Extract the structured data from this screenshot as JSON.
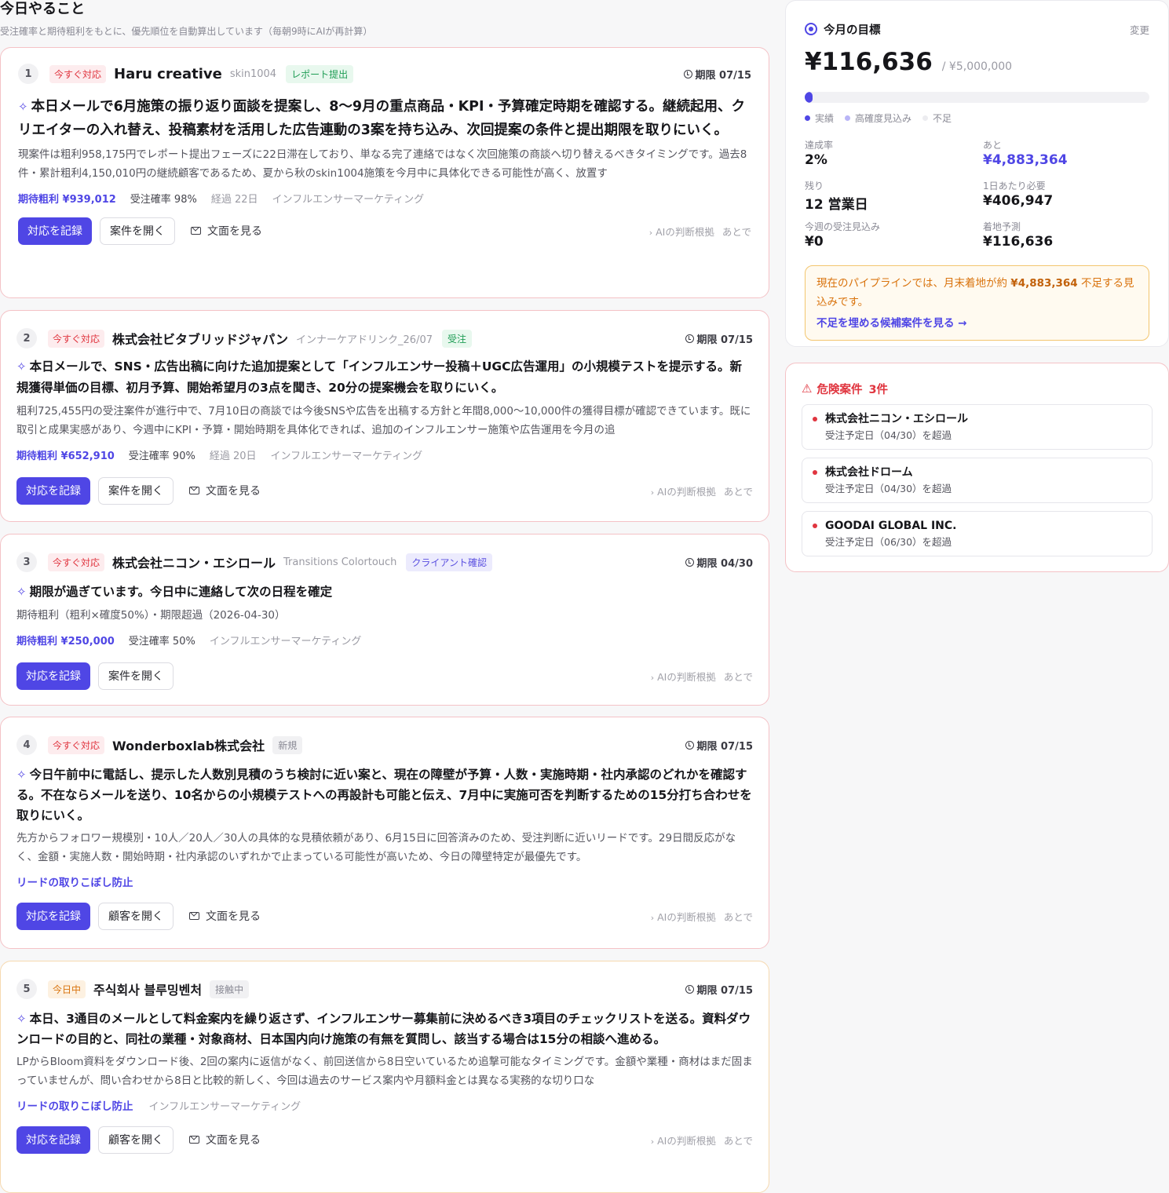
{
  "header": {
    "title": "今日やること",
    "subtitle": "受注確率と期待粗利をもとに、優先順位を自動算出しています（毎朝9時にAIが再計算）"
  },
  "common": {
    "record_label": "対応を記録",
    "view_text_label": "文面を見る",
    "ai_reason_label": "AIの判断根拠",
    "later_label": "あとで"
  },
  "tasks": [
    {
      "number": "1",
      "priority": "今すぐ対応",
      "company": "Haru creative",
      "project": "skin1004",
      "stage": "レポート提出",
      "deadline": "期限 07/15",
      "action": "本日メールで6月施策の振り返り面談を提案し、8〜9月の重点商品・KPI・予算確定時期を確認する。継続起用、クリエイターの入れ替え、投稿素材を活用した広告連動の3案を持ち込み、次回提案の条件と提出期限を取りにいく。",
      "reason": "現案件は粗利958,175円でレポート提出フェーズに22日滞在しており、単なる完了連絡ではなく次回施策の商談へ切り替えるべきタイミングです。過去8件・累計粗利4,150,010円の継続顧客であるため、夏から秋のskin1004施策を今月中に具体化できる可能性が高く、放置す",
      "expected": "期待粗利 ¥939,012",
      "probability": "受注確率 98%",
      "elapsed": "経過 22日",
      "category": "インフルエンサーマーケティング",
      "open_label": "案件を開く"
    },
    {
      "number": "2",
      "priority": "今すぐ対応",
      "company": "株式会社ビタブリッドジャパン",
      "project": "インナーケアドリンク_26/07",
      "stage": "受注",
      "deadline": "期限 07/15",
      "action": "本日メールで、SNS・広告出稿に向けた追加提案として「インフルエンサー投稿＋UGC広告運用」の小規模テストを提示する。新規獲得単価の目標、初月予算、開始希望月の3点を聞き、20分の提案機会を取りにいく。",
      "reason": "粗利725,455円の受注案件が進行中で、7月10日の商談では今後SNSや広告を出稿する方針と年間8,000〜10,000件の獲得目標が確認できています。既に取引と成果実感があり、今週中にKPI・予算・開始時期を具体化できれば、追加のインフルエンサー施策や広告運用を今月の追",
      "expected": "期待粗利 ¥652,910",
      "probability": "受注確率 90%",
      "elapsed": "経過 20日",
      "category": "インフルエンサーマーケティング",
      "open_label": "案件を開く"
    },
    {
      "number": "3",
      "priority": "今すぐ対応",
      "company": "株式会社ニコン・エシロール",
      "project": "Transitions Colortouch",
      "stage": "クライアント確認",
      "deadline": "期限 04/30",
      "action": "期限が過ぎています。今日中に連絡して次の日程を確定",
      "reason": "期待粗利（粗利×確度50%）・期限超過（2026-04-30）",
      "expected": "期待粗利 ¥250,000",
      "probability": "受注確率 50%",
      "category": "インフルエンサーマーケティング",
      "open_label": "案件を開く"
    },
    {
      "number": "4",
      "priority": "今すぐ対応",
      "company": "Wonderboxlab株式会社",
      "stage": "新規",
      "deadline": "期限 07/15",
      "action": "今日午前中に電話し、提示した人数別見積のうち検討に近い案と、現在の障壁が予算・人数・実施時期・社内承認のどれかを確認する。不在ならメールを送り、10名からの小規模テストへの再設計も可能と伝え、7月中に実施可否を判断するための15分打ち合わせを取りにいく。",
      "reason": "先方からフォロワー規模別・10人／20人／30人の具体的な見積依頼があり、6月15日に回答済みのため、受注判断に近いリードです。29日間反応がなく、金額・実施人数・開始時期・社内承認のいずれかで止まっている可能性が高いため、今日の障壁特定が最優先です。",
      "lead_tag": "リードの取りこぼし防止",
      "open_label": "顧客を開く"
    },
    {
      "number": "5",
      "priority": "今日中",
      "company": "주식회사 블루밍벤처",
      "stage": "接触中",
      "deadline": "期限 07/15",
      "action": "本日、3通目のメールとして料金案内を繰り返さず、インフルエンサー募集前に決めるべき3項目のチェックリストを送る。資料ダウンロードの目的と、同社の業種・対象商材、日本国内向け施策の有無を質問し、該当する場合は15分の相談へ進める。",
      "reason": "LPからBloom資料をダウンロード後、2回の案内に返信がなく、前回送信から8日空いているため追撃可能なタイミングです。金額や業種・商材はまだ固まっていませんが、問い合わせから8日と比較的新しく、今回は過去のサービス案内や月額料金とは異なる実務的な切り口な",
      "lead_tag": "リードの取りこぼし防止",
      "category": "インフルエンサーマーケティング",
      "open_label": "顧客を開く"
    }
  ],
  "goal": {
    "title": "今月の目標",
    "change_label": "変更",
    "amount": "¥116,636",
    "target": "/ ¥5,000,000",
    "progress_percent": 2,
    "legend": {
      "actual": "実績",
      "likely": "高確度見込み",
      "shortfall": "不足"
    },
    "stats": {
      "rate_label": "達成率",
      "rate_value": "2%",
      "remaining_amount_label": "あと",
      "remaining_amount_value": "¥4,883,364",
      "remaining_days_label": "残り",
      "remaining_days_value": "12 営業日",
      "daily_label": "1日あたり必要",
      "daily_value": "¥406,947",
      "weekly_label": "今週の受注見込み",
      "weekly_value": "¥0",
      "forecast_label": "着地予測",
      "forecast_value": "¥116,636"
    },
    "alert": {
      "before": "現在のパイプラインでは、月末着地が約",
      "amount": "¥4,883,364",
      "after": "不足する見込みです。",
      "link": "不足を埋める候補案件を見る →"
    },
    "colors": {
      "actual": "#4f46e5",
      "likely": "#b9b5f7",
      "shortfall": "#ececf0"
    }
  },
  "risk": {
    "title": "危険案件",
    "count": "3件",
    "items": [
      {
        "name": "株式会社ニコン・エシロール",
        "note": "受注予定日（04/30）を超過"
      },
      {
        "name": "株式会社ドローム",
        "note": "受注予定日（04/30）を超過"
      },
      {
        "name": "GOODAI GLOBAL INC.",
        "note": "受注予定日（06/30）を超過"
      }
    ]
  }
}
